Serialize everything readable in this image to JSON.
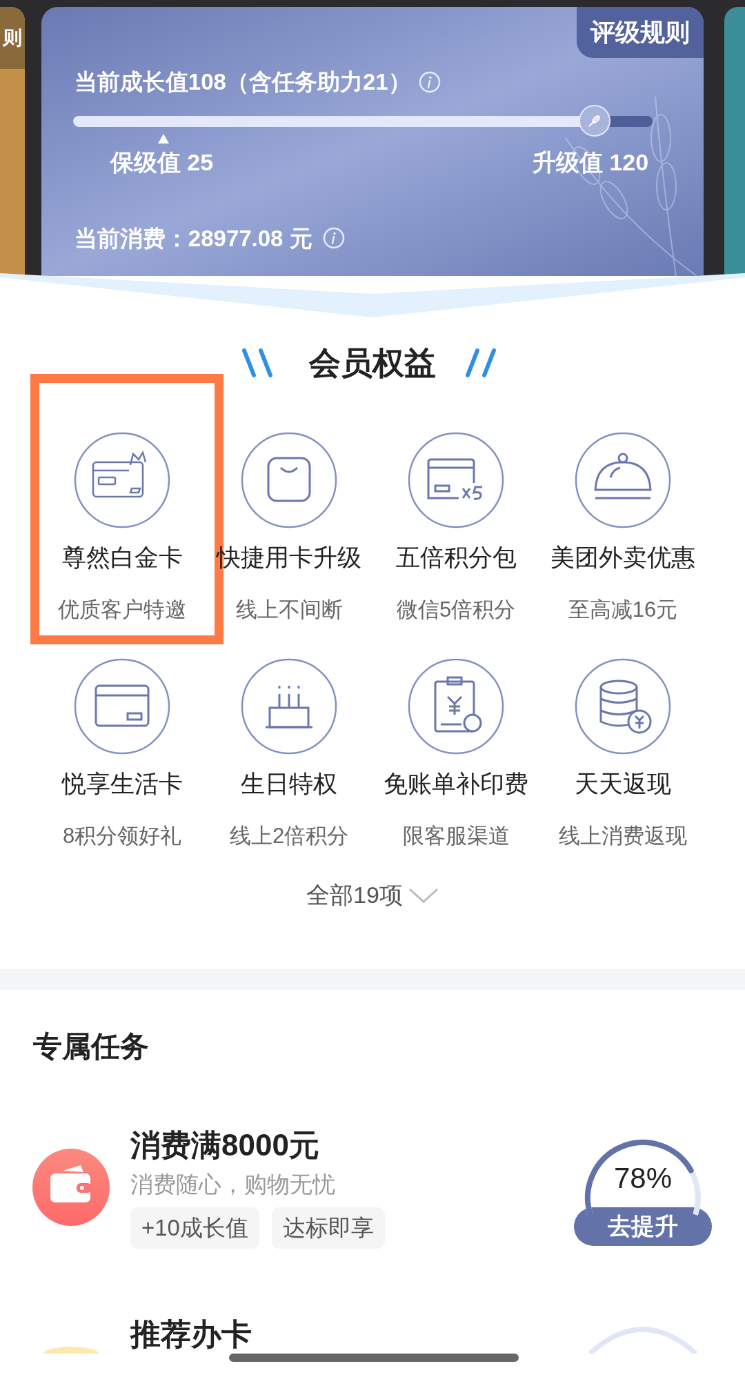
{
  "side_card_left": {
    "text": "则"
  },
  "member_card": {
    "rules_button": "评级规则",
    "growth_text": "当前成长值108（含任务助力21）",
    "progress": {
      "level": 0.9
    },
    "keep_label": "保级值 25",
    "upgrade_label": "升级值 120",
    "spending_text": "当前消费：28977.08 元"
  },
  "benefits": {
    "title": "会员权益",
    "items": [
      {
        "title": "尊然白金卡",
        "subtitle": "优质客户特邀",
        "kind": "card-crown",
        "highlighted": true
      },
      {
        "title": "快捷用卡升级",
        "subtitle": "线上不间断",
        "kind": "bag",
        "highlighted": false
      },
      {
        "title": "五倍积分包",
        "subtitle": "微信5倍积分",
        "kind": "card-x5",
        "highlighted": false
      },
      {
        "title": "美团外卖优惠",
        "subtitle": "至高减16元",
        "kind": "cloche",
        "highlighted": false
      },
      {
        "title": "悦享生活卡",
        "subtitle": "8积分领好礼",
        "kind": "card",
        "highlighted": false
      },
      {
        "title": "生日特权",
        "subtitle": "线上2倍积分",
        "kind": "cake",
        "highlighted": false
      },
      {
        "title": "免账单补印费",
        "subtitle": "限客服渠道",
        "kind": "bill",
        "highlighted": false
      },
      {
        "title": "天天返现",
        "subtitle": "线上消费返现",
        "kind": "coins",
        "highlighted": false
      }
    ],
    "more_link": "全部19项"
  },
  "tasks": {
    "title": "专属任务",
    "items": [
      {
        "title": "消费满8000元",
        "subtitle": "消费随心，购物无忧",
        "tags": [
          "+10成长值",
          "达标即享"
        ],
        "percent": "78%",
        "button": "去提升",
        "kind": "wallet"
      },
      {
        "title": "推荐办卡",
        "kind": "partial"
      }
    ]
  }
}
